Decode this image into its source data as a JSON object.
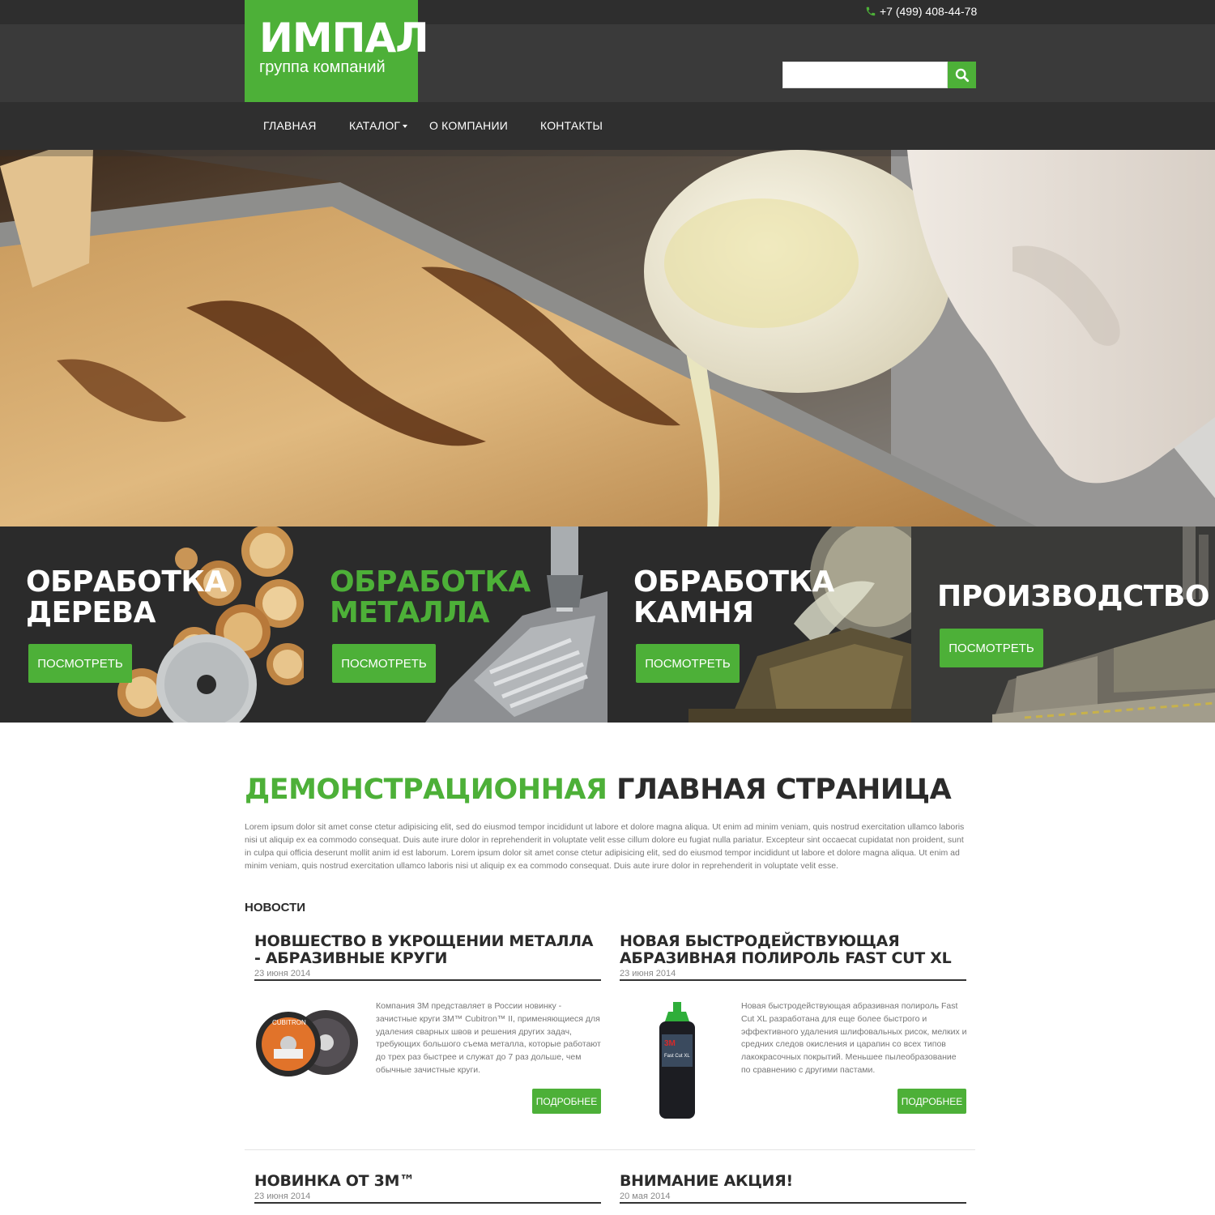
{
  "header": {
    "phone": "+7 (499) 408-44-78",
    "logo_title": "ИМПАЛ",
    "logo_subtitle": "группа компаний",
    "search_placeholder": ""
  },
  "nav": {
    "items": [
      "ГЛАВНАЯ",
      "КАТАЛОГ",
      "О КОМПАНИИ",
      "КОНТАКТЫ"
    ]
  },
  "tiles": [
    {
      "line1": "ОБРАБОТКА",
      "line2": "ДЕРЕВА",
      "button": "ПОСМОТРЕТЬ"
    },
    {
      "line1": "ОБРАБОТКА",
      "line2": "МЕТАЛЛА",
      "button": "ПОСМОТРЕТЬ"
    },
    {
      "line1": "ОБРАБОТКА",
      "line2": "КАМНЯ",
      "button": "ПОСМОТРЕТЬ"
    },
    {
      "line1": "ПРОИЗВОДСТВО",
      "line2": "",
      "button": "ПОСМОТРЕТЬ"
    }
  ],
  "main": {
    "title_green": "ДЕМОНСТРАЦИОННАЯ",
    "title_dark": "ГЛАВНАЯ СТРАНИЦА",
    "intro": "Lorem ipsum dolor sit amet conse ctetur adipisicing elit, sed do eiusmod tempor incididunt ut labore et dolore magna aliqua. Ut enim ad minim veniam, quis nostrud exercitation ullamco laboris nisi ut aliquip ex ea commodo consequat. Duis aute irure dolor in reprehenderit in voluptate velit esse cillum dolore eu fugiat nulla pariatur. Excepteur sint occaecat cupidatat non proident, sunt in culpa qui officia deserunt mollit anim id est laborum. Lorem ipsum dolor sit amet conse ctetur adipisicing elit, sed do eiusmod tempor incididunt ut labore et dolore magna aliqua. Ut enim ad minim veniam, quis nostrud exercitation ullamco laboris nisi ut aliquip ex ea commodo consequat. Duis aute irure dolor in reprehenderit in voluptate velit esse.",
    "news_label": "НОВОСТИ"
  },
  "news": [
    {
      "title": "НОВШЕСТВО В УКРОЩЕНИИ МЕТАЛЛА - АБРАЗИВНЫЕ КРУГИ",
      "date": "23 июня 2014",
      "text": "Компания 3М представляет в России новинку - зачистные круги 3M™ Cubitron™ II, применяющиеся для удаления сварных швов и решения других задач, требующих большого съема металла, которые работают до трех раз быстрее и служат до 7 раз дольше, чем обычные зачистные круги.",
      "more": "ПОДРОБНЕЕ",
      "img_label": "CUBITRON"
    },
    {
      "title": "НОВАЯ БЫСТРОДЕЙСТВУЮЩАЯ АБРАЗИВНАЯ ПОЛИРОЛЬ FAST CUT XL",
      "date": "23 июня 2014",
      "text": "Новая быстродействующая абразивная полироль Fast Cut XL разработана для еще более быстрого и эффективного удаления шлифовальных рисок, мелких и средних следов окисления и царапин со всех типов лакокрасочных покрытий. Меньшее пылеобразование по сравнению с другими пастами.",
      "more": "ПОДРОБНЕЕ",
      "img_brand": "3M",
      "img_label": "Fast Cut XL"
    },
    {
      "title": "НОВИНКА ОТ 3M™",
      "date": "23 июня 2014"
    },
    {
      "title": "ВНИМАНИЕ АКЦИЯ!",
      "date": "20 мая 2014"
    }
  ],
  "colors": {
    "accent": "#4db038",
    "header_bg": "#3a3a3a",
    "nav_bg": "#2f2f2f",
    "tile_bg": "#2b2b2b"
  },
  "icons": {
    "phone": "phone-icon",
    "search": "search-icon"
  }
}
